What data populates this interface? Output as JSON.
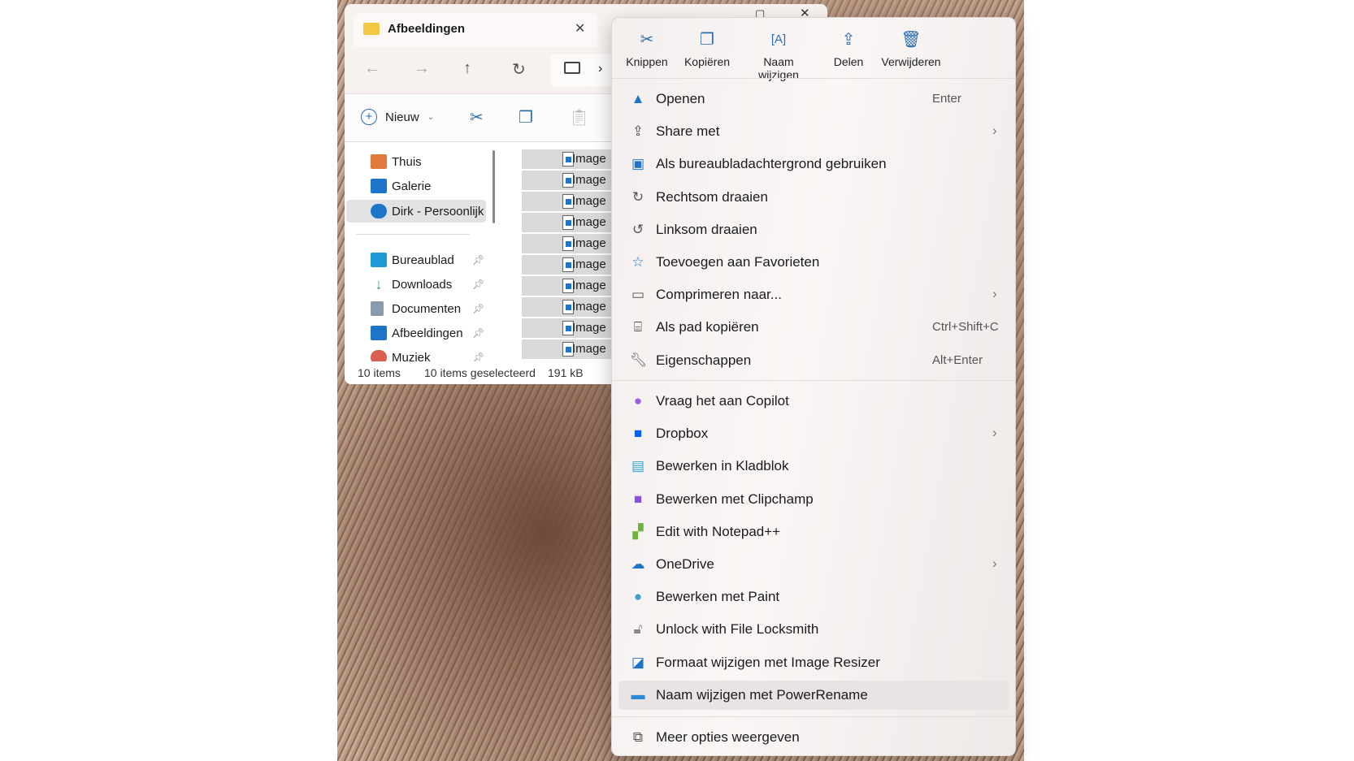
{
  "explorer": {
    "tab_title": "Afbeeldingen",
    "toolbar": {
      "new_label": "Nieuw"
    },
    "nav_pane": [
      {
        "label": "Thuis",
        "icon": "home-icon",
        "color": "#e07a3c"
      },
      {
        "label": "Galerie",
        "icon": "gallery-icon",
        "color": "#1e74c9"
      },
      {
        "label": "Dirk - Persoonlijk",
        "icon": "onedrive-icon",
        "color": "#1e74c9",
        "selected": true
      },
      {
        "label": "Bureaublad",
        "icon": "desktop-icon",
        "color": "#1e9bd7",
        "pinned": true
      },
      {
        "label": "Downloads",
        "icon": "download-icon",
        "color": "#2fa86a",
        "pinned": true
      },
      {
        "label": "Documenten",
        "icon": "document-icon",
        "color": "#8a9bb0",
        "pinned": true
      },
      {
        "label": "Afbeeldingen",
        "icon": "pictures-icon",
        "color": "#1e74c9",
        "pinned": true
      },
      {
        "label": "Muziek",
        "icon": "music-icon",
        "color": "#d9604f",
        "pinned": true
      }
    ],
    "files": [
      "Image",
      "Image",
      "Image",
      "Image",
      "Image",
      "Image",
      "Image",
      "Image",
      "Image",
      "Image"
    ],
    "status": {
      "count": "10 items",
      "selected": "10 items geselecteerd",
      "size": "191 kB"
    }
  },
  "menu": {
    "toolbar": [
      {
        "label": "Knippen",
        "icon": "cut-icon"
      },
      {
        "label": "Kopiëren",
        "icon": "copy-icon"
      },
      {
        "label": "Naam wijzigen",
        "icon": "rename-icon"
      },
      {
        "label": "Delen",
        "icon": "share-icon"
      },
      {
        "label": "Verwijderen",
        "icon": "delete-icon"
      }
    ],
    "group1": [
      {
        "label": "Openen",
        "shortcut": "Enter",
        "icon": "photos-icon"
      },
      {
        "label": "Share met",
        "submenu": true,
        "icon": "share-icon"
      },
      {
        "label": "Als bureaubladachtergrond gebruiken",
        "icon": "wallpaper-icon"
      },
      {
        "label": "Rechtsom draaien",
        "icon": "rotate-right-icon"
      },
      {
        "label": "Linksom draaien",
        "icon": "rotate-left-icon"
      },
      {
        "label": "Toevoegen aan Favorieten",
        "icon": "star-icon"
      },
      {
        "label": "Comprimeren naar...",
        "submenu": true,
        "icon": "zip-folder-icon"
      },
      {
        "label": "Als pad kopiëren",
        "shortcut": "Ctrl+Shift+C",
        "icon": "copy-path-icon"
      },
      {
        "label": "Eigenschappen",
        "shortcut": "Alt+Enter",
        "icon": "wrench-icon"
      }
    ],
    "group2": [
      {
        "label": "Vraag het aan Copilot",
        "icon": "copilot-icon"
      },
      {
        "label": "Dropbox",
        "submenu": true,
        "icon": "dropbox-icon"
      },
      {
        "label": "Bewerken in Kladblok",
        "icon": "notepad-icon"
      },
      {
        "label": "Bewerken met Clipchamp",
        "icon": "clipchamp-icon"
      },
      {
        "label": "Edit with Notepad++",
        "icon": "notepadpp-icon"
      },
      {
        "label": "OneDrive",
        "submenu": true,
        "icon": "onedrive-icon"
      },
      {
        "label": "Bewerken met Paint",
        "icon": "paint-icon"
      },
      {
        "label": "Unlock with File Locksmith",
        "icon": "lock-icon"
      },
      {
        "label": "Formaat wijzigen met Image Resizer",
        "icon": "image-resizer-icon"
      },
      {
        "label": "Naam wijzigen met PowerRename",
        "icon": "powerrename-icon",
        "highlighted": true
      }
    ],
    "more": {
      "label": "Meer opties weergeven",
      "icon": "more-options-icon"
    }
  }
}
